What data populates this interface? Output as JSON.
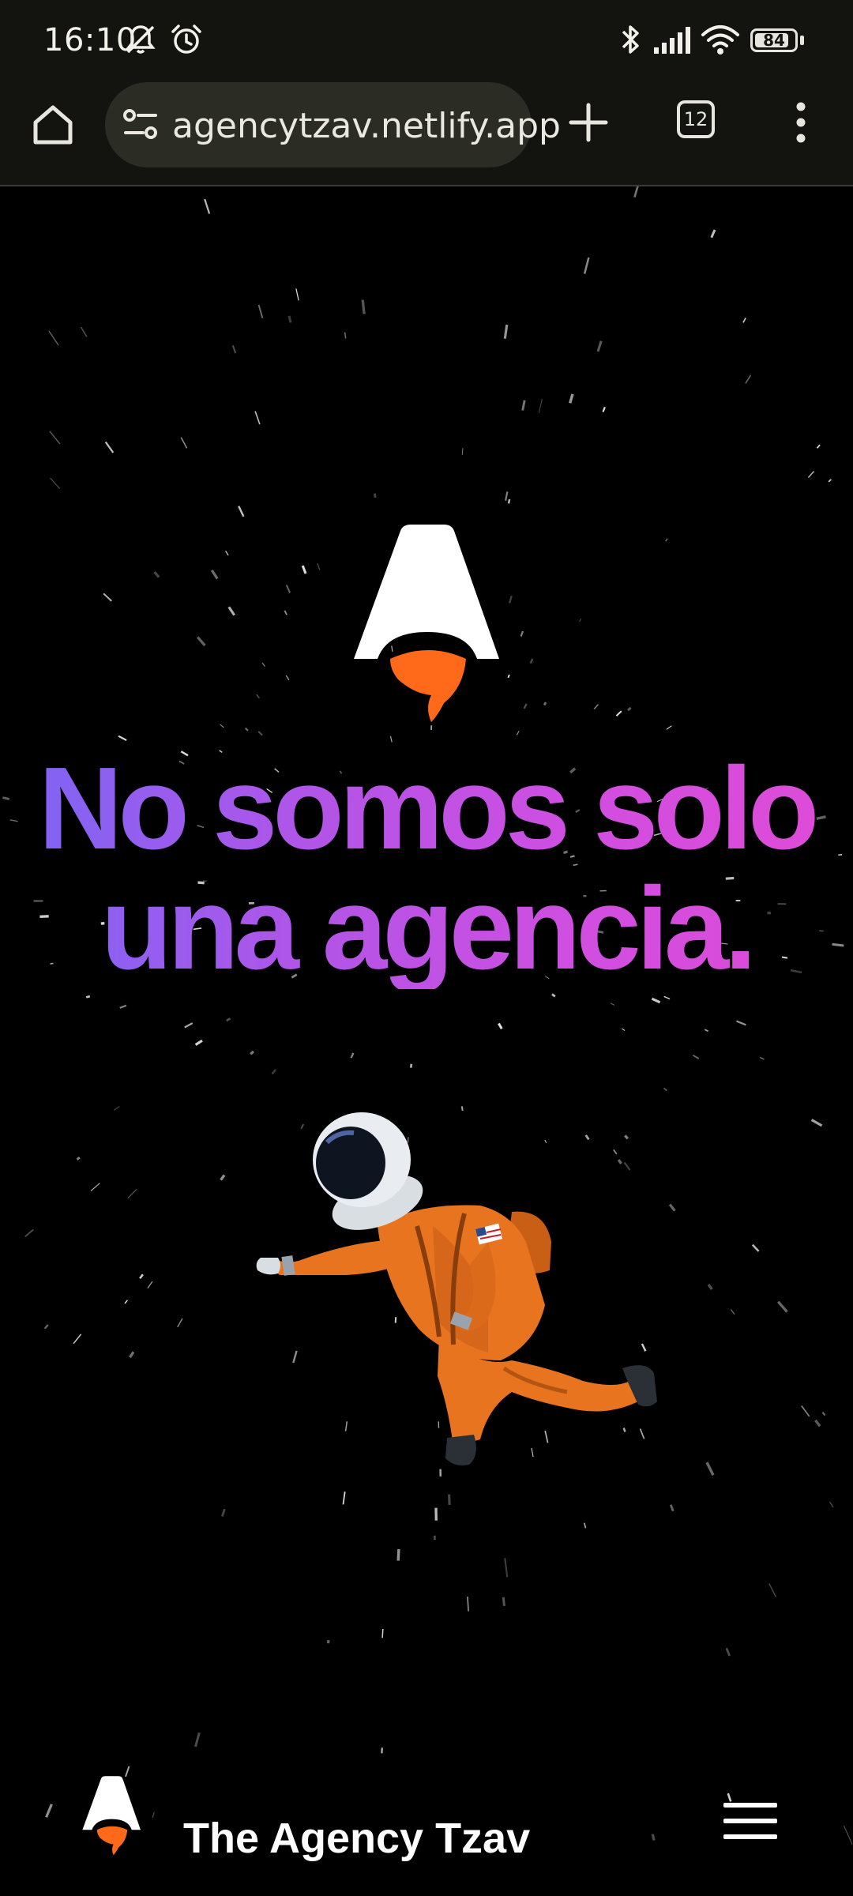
{
  "status_bar": {
    "time": "16:10",
    "battery_level": "84",
    "icons": [
      "mute-icon",
      "alarm-icon",
      "bluetooth-icon",
      "signal-icon",
      "wifi-icon",
      "battery-icon"
    ]
  },
  "browser": {
    "url": "agencytzav.netlify.app",
    "tab_count": "12",
    "icons": [
      "home-icon",
      "site-settings-icon",
      "new-tab-icon",
      "tabs-icon",
      "more-menu-icon"
    ]
  },
  "hero": {
    "headline_line1": "No somos solo",
    "headline_line2": "una agencia.",
    "logo_icon": "rocket-a-logo-icon",
    "illustration": "astronaut-illustration"
  },
  "footer_nav": {
    "brand_name": "The Agency Tzav",
    "menu_icon": "hamburger-menu-icon"
  },
  "colors": {
    "background": "#000000",
    "toolbar": "#13130f",
    "url_pill": "#2b2c24",
    "gradient_start": "#7b66f5",
    "gradient_end": "#de4bd6",
    "flame": "#ff6a1a",
    "suit": "#e8741f"
  }
}
